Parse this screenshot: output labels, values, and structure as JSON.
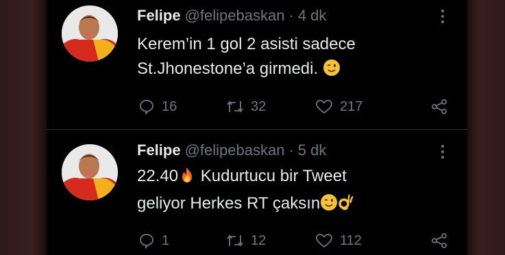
{
  "colors": {
    "background": "#000000",
    "text_primary": "#e7e9ea",
    "text_secondary": "#6e767d",
    "divider": "#2f3336"
  },
  "tweets": [
    {
      "author_name": "Felipe",
      "handle": "@felipebaskan",
      "separator": "·",
      "time": "4 dk",
      "text_line1": "Kerem’in 1 gol 2 asisti sadece",
      "text_line2": "St.Jhonestone’a girmedi.",
      "emojis": [
        "winking-face"
      ],
      "replies": "16",
      "retweets": "32",
      "likes": "217"
    },
    {
      "author_name": "Felipe",
      "handle": "@felipebaskan",
      "separator": "·",
      "time": "5 dk",
      "text_line1_a": "22.40",
      "text_line1_b": "Kudurtucu bir Tweet",
      "text_line2": "geliyor Herkes RT çaksın",
      "emojis": [
        "fire",
        "winking-face",
        "ok-hand"
      ],
      "replies": "1",
      "retweets": "12",
      "likes": "112"
    }
  ],
  "icons": {
    "reply": "reply-icon",
    "retweet": "retweet-icon",
    "like": "heart-icon",
    "share": "share-icon",
    "more": "more-vertical-icon"
  }
}
